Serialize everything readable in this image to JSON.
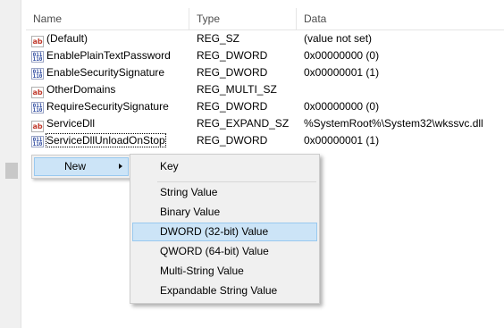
{
  "columns": {
    "name": "Name",
    "type": "Type",
    "data": "Data"
  },
  "rows": [
    {
      "icon": "string-value-icon",
      "name": "(Default)",
      "type": "REG_SZ",
      "data": "(value not set)"
    },
    {
      "icon": "binary-value-icon",
      "name": "EnablePlainTextPassword",
      "type": "REG_DWORD",
      "data": "0x00000000 (0)"
    },
    {
      "icon": "binary-value-icon",
      "name": "EnableSecuritySignature",
      "type": "REG_DWORD",
      "data": "0x00000001 (1)"
    },
    {
      "icon": "string-value-icon",
      "name": "OtherDomains",
      "type": "REG_MULTI_SZ",
      "data": ""
    },
    {
      "icon": "binary-value-icon",
      "name": "RequireSecuritySignature",
      "type": "REG_DWORD",
      "data": "0x00000000 (0)"
    },
    {
      "icon": "string-value-icon",
      "name": "ServiceDll",
      "type": "REG_EXPAND_SZ",
      "data": "%SystemRoot%\\System32\\wkssvc.dll"
    },
    {
      "icon": "binary-value-icon",
      "name": "ServiceDllUnloadOnStop",
      "type": "REG_DWORD",
      "data": "0x00000001 (1)"
    }
  ],
  "context_menu": {
    "new_label": "New"
  },
  "submenu": {
    "items": [
      {
        "label": "Key"
      },
      {
        "label": "String Value"
      },
      {
        "label": "Binary Value"
      },
      {
        "label": "DWORD (32-bit) Value"
      },
      {
        "label": "QWORD (64-bit) Value"
      },
      {
        "label": "Multi-String Value"
      },
      {
        "label": "Expandable String Value"
      }
    ],
    "highlighted_index": 3
  },
  "colors": {
    "menu_highlight": "#cce4f7",
    "menu_highlight_border": "#99c9ef",
    "menu_background": "#f0f0f0",
    "string_icon_text": "#c0392b",
    "binary_icon_text": "#2e4aa0"
  }
}
